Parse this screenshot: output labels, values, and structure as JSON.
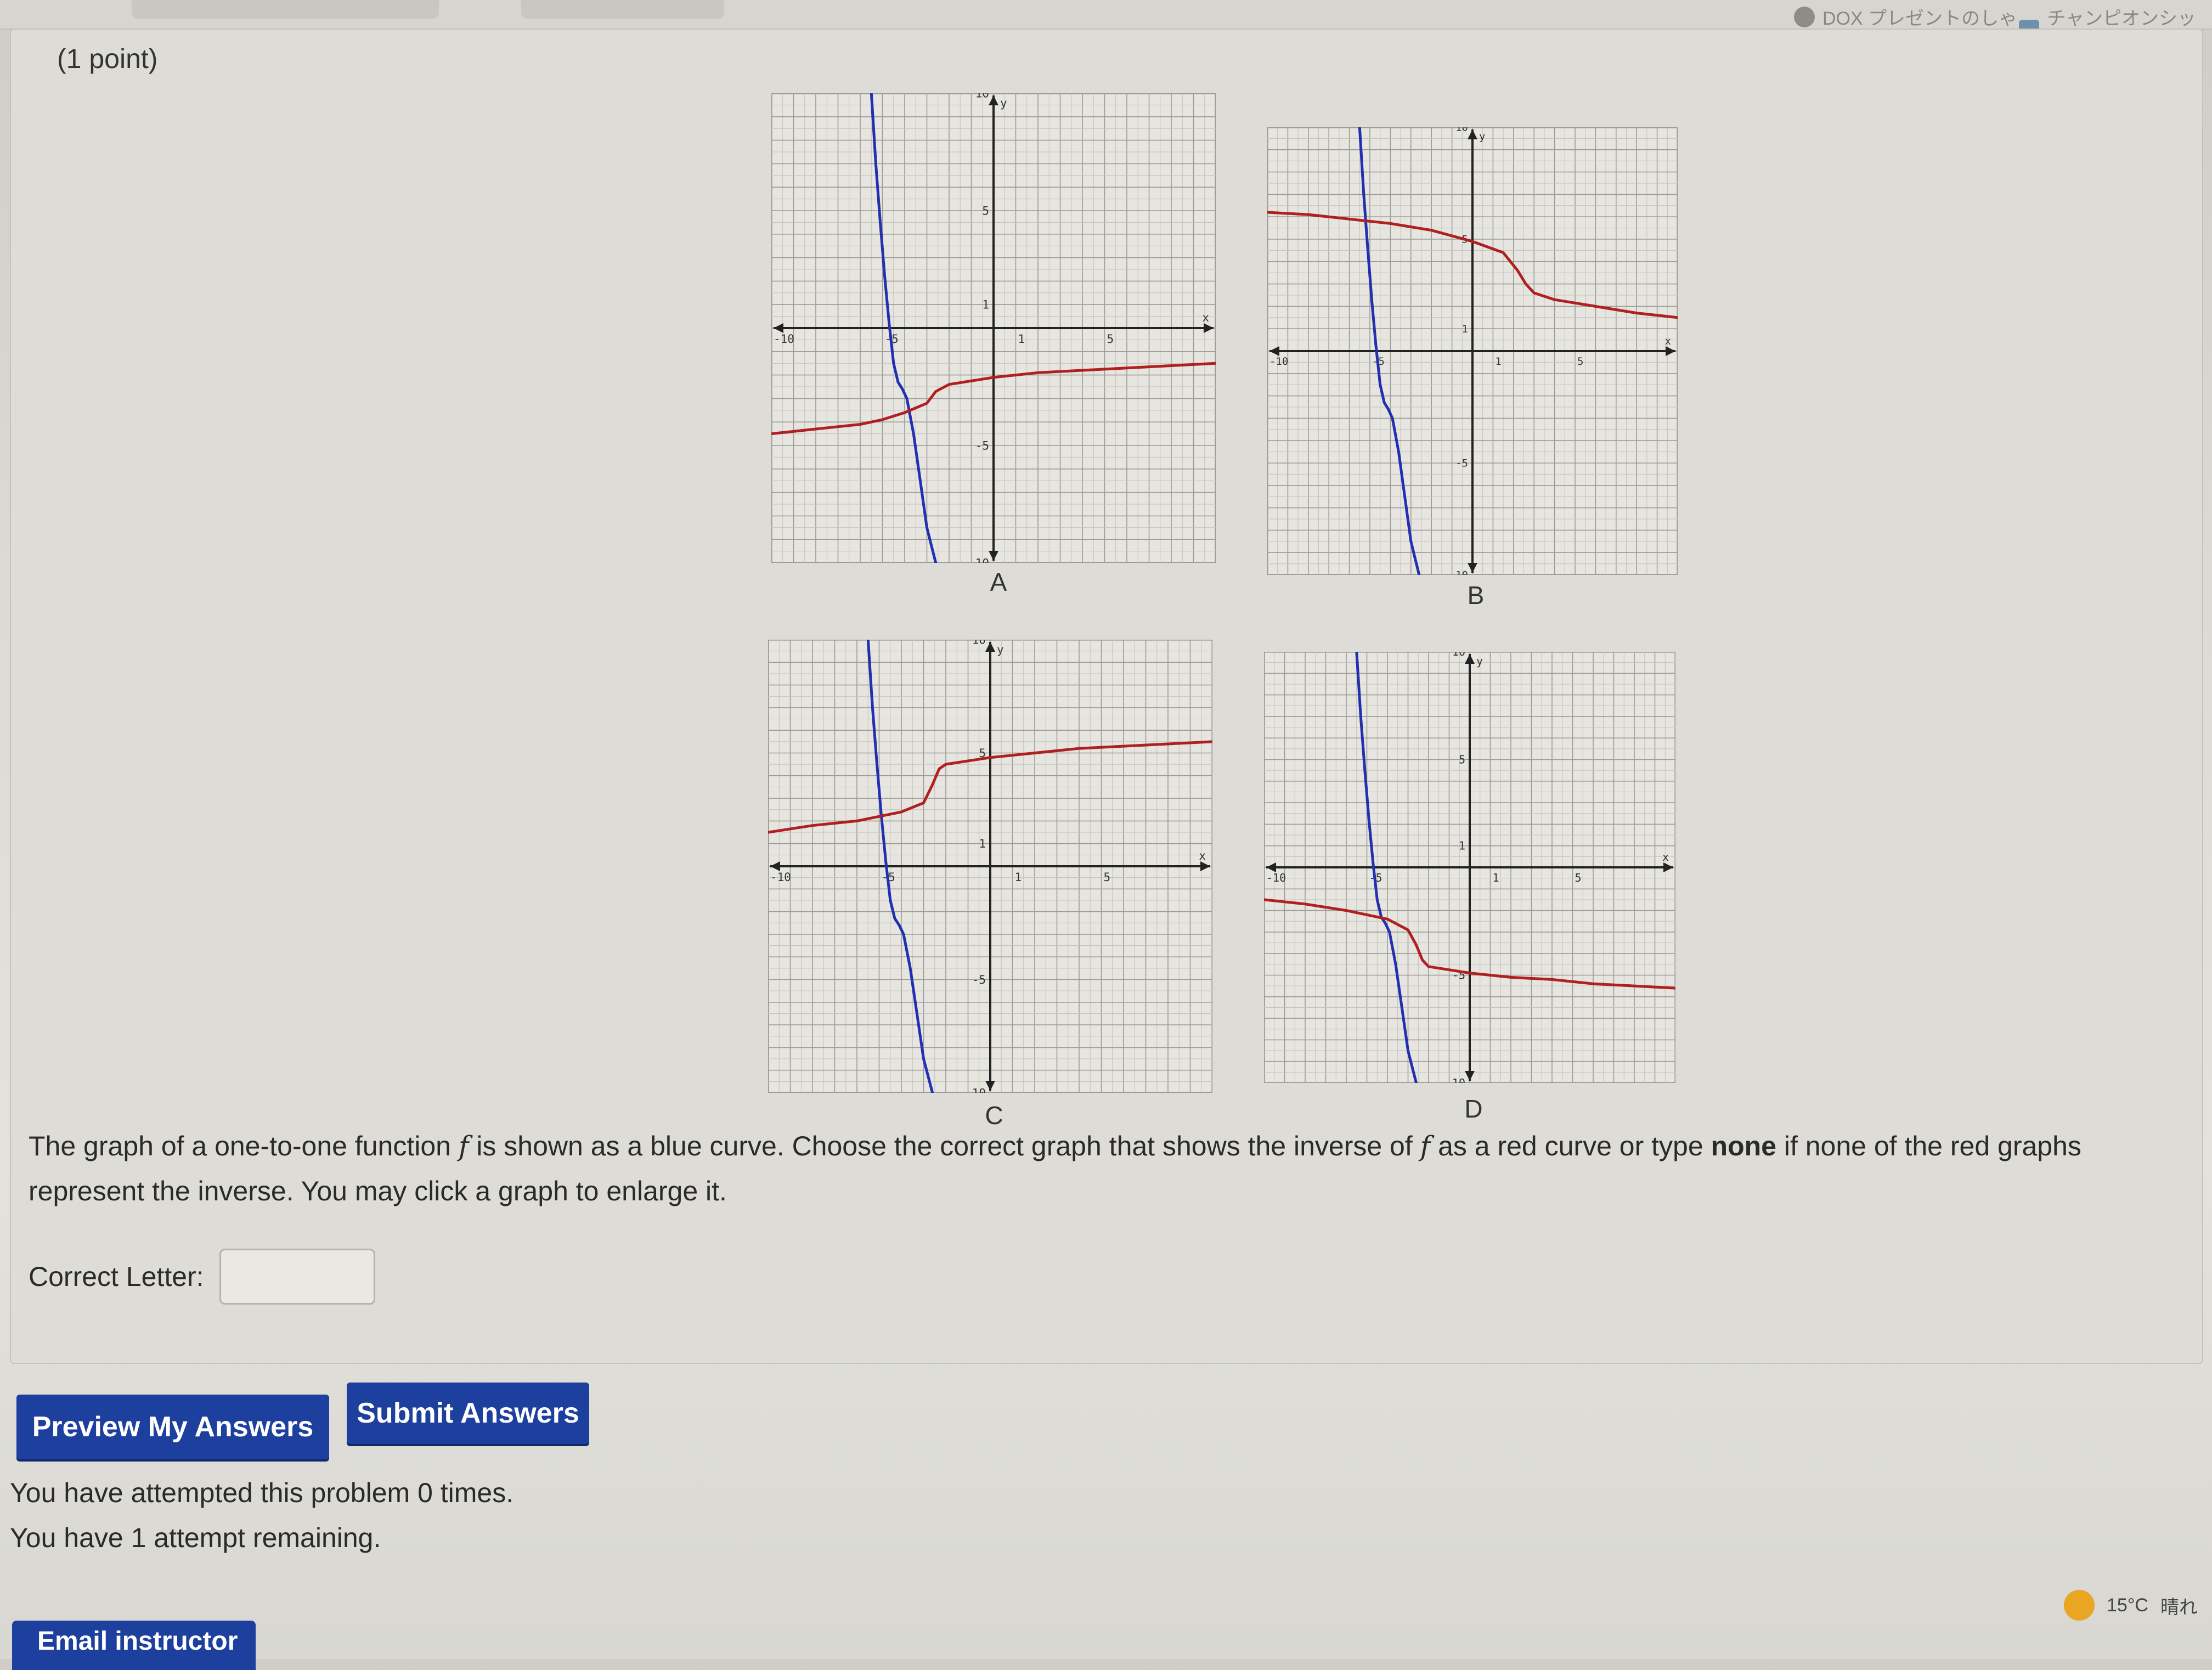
{
  "browser": {
    "bookmarks": [
      {
        "icon": "circle-icon",
        "label": "DOX プレゼントのしゃ"
      },
      {
        "icon": "app-icon",
        "label": "チャンピオンシップ"
      }
    ]
  },
  "problem": {
    "points_label": "(1 point)",
    "graphs": [
      {
        "letter": "A",
        "chart_data": {
          "type": "line",
          "xlim": [
            -10,
            10
          ],
          "ylim": [
            -10,
            10
          ],
          "grid": true,
          "x_ticks": [
            -10,
            -5,
            1,
            5,
            10
          ],
          "y_ticks": [
            10,
            5,
            1,
            -5,
            -10
          ],
          "xlabel": "x",
          "ylabel": "y",
          "series": [
            {
              "color": "#2030b0",
              "x": [
                -5.5,
                -5.3,
                -5.1,
                -4.9,
                -4.7,
                -4.5,
                -4.3,
                -4.1,
                -3.9,
                -3.6,
                -3.3,
                -3.0,
                -2.6
              ],
              "y": [
                10,
                7,
                4.5,
                2.2,
                0.2,
                -1.5,
                -2.3,
                -2.6,
                -3.0,
                -4.5,
                -6.5,
                -8.5,
                -10
              ]
            },
            {
              "color": "#b02020",
              "x": [
                -10,
                -8,
                -6,
                -5,
                -4,
                -3,
                -2.6,
                -2,
                0,
                2,
                4,
                6,
                8,
                10
              ],
              "y": [
                -4.5,
                -4.3,
                -4.1,
                -3.9,
                -3.6,
                -3.2,
                -2.7,
                -2.4,
                -2.1,
                -1.9,
                -1.8,
                -1.7,
                -1.6,
                -1.5
              ]
            }
          ]
        }
      },
      {
        "letter": "B",
        "chart_data": {
          "type": "line",
          "xlim": [
            -10,
            10
          ],
          "ylim": [
            -10,
            10
          ],
          "grid": true,
          "x_ticks": [
            -10,
            -5,
            1,
            5,
            10
          ],
          "y_ticks": [
            10,
            5,
            1,
            -5,
            -10
          ],
          "xlabel": "x",
          "ylabel": "y",
          "series": [
            {
              "color": "#2030b0",
              "x": [
                -5.5,
                -5.3,
                -5.1,
                -4.9,
                -4.7,
                -4.5,
                -4.3,
                -4.1,
                -3.9,
                -3.6,
                -3.3,
                -3.0,
                -2.6
              ],
              "y": [
                10,
                7,
                4.5,
                2.2,
                0.2,
                -1.5,
                -2.3,
                -2.6,
                -3.0,
                -4.5,
                -6.5,
                -8.5,
                -10
              ]
            },
            {
              "color": "#b02020",
              "x": [
                -10,
                -8,
                -6,
                -4,
                -2,
                0,
                1.5,
                2.2,
                2.6,
                3,
                4,
                6,
                8,
                10
              ],
              "y": [
                6.2,
                6.1,
                5.9,
                5.7,
                5.4,
                4.9,
                4.4,
                3.6,
                3.0,
                2.6,
                2.3,
                2.0,
                1.7,
                1.5
              ]
            }
          ]
        }
      },
      {
        "letter": "C",
        "chart_data": {
          "type": "line",
          "xlim": [
            -10,
            10
          ],
          "ylim": [
            -10,
            10
          ],
          "grid": true,
          "x_ticks": [
            -10,
            -5,
            1,
            5,
            10
          ],
          "y_ticks": [
            10,
            5,
            1,
            -5,
            -10
          ],
          "xlabel": "x",
          "ylabel": "y",
          "series": [
            {
              "color": "#2030b0",
              "x": [
                -5.5,
                -5.3,
                -5.1,
                -4.9,
                -4.7,
                -4.5,
                -4.3,
                -4.1,
                -3.9,
                -3.6,
                -3.3,
                -3.0,
                -2.6
              ],
              "y": [
                10,
                7,
                4.5,
                2.2,
                0.2,
                -1.5,
                -2.3,
                -2.6,
                -3.0,
                -4.5,
                -6.5,
                -8.5,
                -10
              ]
            },
            {
              "color": "#b02020",
              "x": [
                -10,
                -8,
                -6,
                -4,
                -3,
                -2.6,
                -2.3,
                -2,
                0,
                2,
                4,
                6,
                8,
                10
              ],
              "y": [
                1.5,
                1.8,
                2.0,
                2.4,
                2.8,
                3.6,
                4.3,
                4.5,
                4.8,
                5.0,
                5.2,
                5.3,
                5.4,
                5.5
              ]
            }
          ]
        }
      },
      {
        "letter": "D",
        "chart_data": {
          "type": "line",
          "xlim": [
            -10,
            10
          ],
          "ylim": [
            -10,
            10
          ],
          "grid": true,
          "x_ticks": [
            -10,
            -5,
            1,
            5,
            10
          ],
          "y_ticks": [
            10,
            5,
            1,
            -5,
            -10
          ],
          "xlabel": "x",
          "ylabel": "y",
          "series": [
            {
              "color": "#2030b0",
              "x": [
                -5.5,
                -5.3,
                -5.1,
                -4.9,
                -4.7,
                -4.5,
                -4.3,
                -4.1,
                -3.9,
                -3.6,
                -3.3,
                -3.0,
                -2.6
              ],
              "y": [
                10,
                7,
                4.5,
                2.2,
                0.2,
                -1.5,
                -2.3,
                -2.6,
                -3.0,
                -4.5,
                -6.5,
                -8.5,
                -10
              ]
            },
            {
              "color": "#b02020",
              "x": [
                -10,
                -8,
                -6,
                -4,
                -3,
                -2.6,
                -2.3,
                -2,
                0,
                2,
                4,
                6,
                8,
                10
              ],
              "y": [
                -1.5,
                -1.7,
                -2.0,
                -2.4,
                -2.9,
                -3.6,
                -4.3,
                -4.6,
                -4.9,
                -5.1,
                -5.2,
                -5.4,
                -5.5,
                -5.6
              ]
            }
          ]
        }
      }
    ],
    "instructions": {
      "part1": "The graph of a one-to-one function ",
      "fvar": "f",
      "part2": " is shown as a blue curve. Choose the correct graph that shows the inverse of ",
      "part3": " as a red curve or type ",
      "keyword": "none",
      "part4": " if none of the red graphs represent the inverse. You may click a graph to enlarge it."
    },
    "answer": {
      "label": "Correct Letter:",
      "value": ""
    }
  },
  "buttons": {
    "preview": "Preview My Answers",
    "submit": "Submit Answers",
    "email": "Email instructor"
  },
  "attempts": {
    "line1": "You have attempted this problem 0 times.",
    "line2": "You have 1 attempt remaining."
  },
  "taskbar": {
    "temperature": "15°C",
    "condition": "晴れ"
  },
  "colors": {
    "button_blue": "#1d3f9e",
    "curve_blue": "#2030b0",
    "curve_red": "#b02020"
  }
}
